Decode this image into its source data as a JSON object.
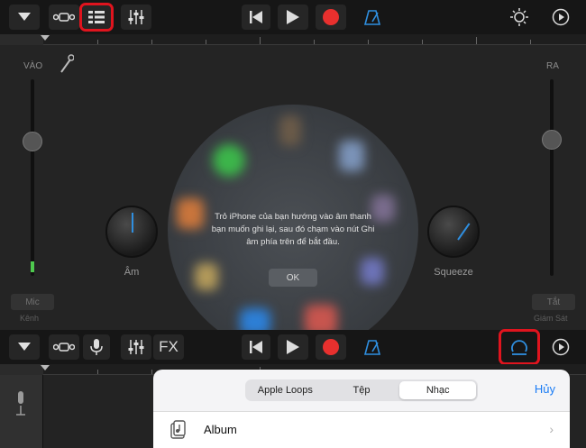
{
  "panel": {
    "in_label": "VÀO",
    "out_label": "RA",
    "mic_chip": "Mic",
    "mic_sub": "Kênh",
    "off_chip": "Tắt",
    "off_sub": "Giám Sát"
  },
  "knobs": {
    "left_label": "Âm",
    "right_label": "Squeeze"
  },
  "dialog": {
    "message": "Trỏ iPhone của bạn hướng vào âm thanh bạn muốn ghi lại, sau đó chạm vào nút Ghi âm phía trên để bắt đầu.",
    "ok": "OK"
  },
  "bottom_toolbar": {
    "fx": "FX"
  },
  "browser": {
    "tabs": [
      "Apple Loops",
      "Tệp",
      "Nhạc"
    ],
    "selected_tab": "Nhạc",
    "cancel": "Hủy",
    "rows": [
      {
        "label": "Album"
      }
    ]
  },
  "colors": {
    "highlight": "#e0141e",
    "record": "#e8302e",
    "accent": "#2f8fe0",
    "level": "#4ec94e"
  }
}
